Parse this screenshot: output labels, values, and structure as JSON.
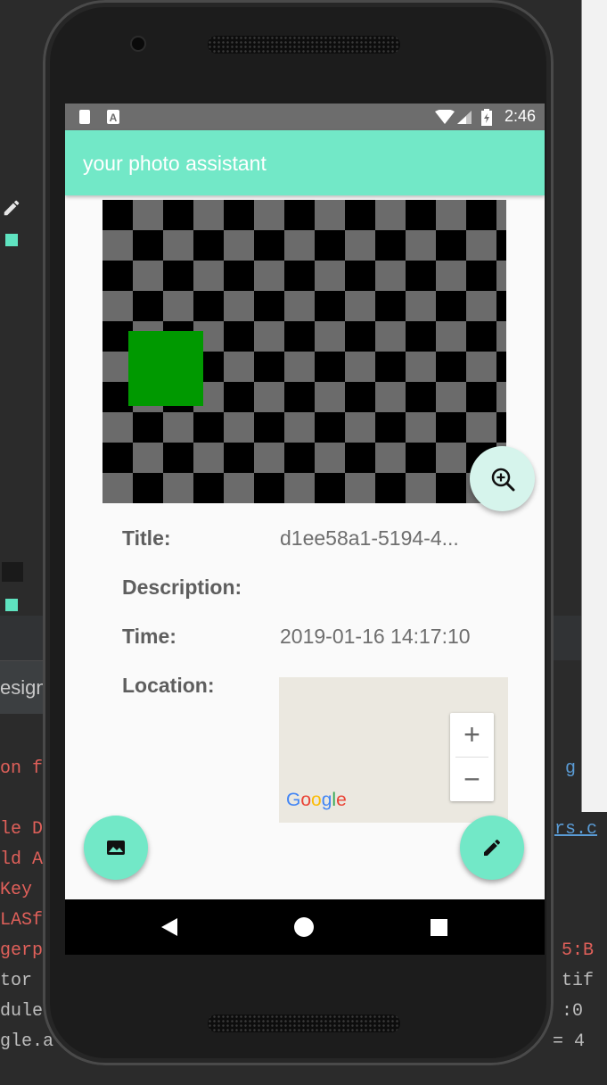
{
  "status_bar": {
    "time": "2:46"
  },
  "app_bar": {
    "title": "your photo assistant"
  },
  "details": {
    "title_label": "Title:",
    "title_value": "d1ee58a1-5194-4...",
    "description_label": "Description:",
    "description_value": "",
    "time_label": "Time:",
    "time_value": "2019-01-16 14:17:10",
    "location_label": "Location:"
  },
  "map": {
    "zoom_in_label": "+",
    "zoom_out_label": "−",
    "attribution": "Google"
  },
  "ide_background": {
    "tab_label": "esign",
    "red_lines": [
      "on f",
      "le D",
      "ld A",
      "Key",
      "LASf",
      "gerp"
    ],
    "grey_lines": [
      "tor",
      "dule",
      "gle.a"
    ],
    "right_lines": [
      "g",
      "rs.c",
      "5:B",
      "tif",
      ":0",
      "= 4"
    ]
  },
  "colors": {
    "accent": "#72e8c7",
    "status_bar": "#6d6d6d",
    "photo_checker_dark": "#000000",
    "photo_checker_light": "#6b6b6b",
    "photo_square": "#009900"
  },
  "icons": {
    "zoom_fab": "zoom-in-magnifier-icon",
    "gallery_fab": "image-icon",
    "edit_fab": "pencil-icon",
    "nav_back": "triangle-back-icon",
    "nav_home": "circle-home-icon",
    "nav_recents": "square-recents-icon"
  }
}
